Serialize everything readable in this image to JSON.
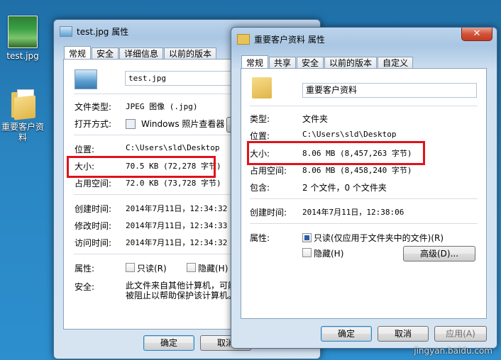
{
  "desktop": {
    "icons": [
      {
        "label": "test.jpg"
      },
      {
        "label": "重要客户资料"
      }
    ]
  },
  "left_window": {
    "title": "test.jpg 属性",
    "tabs": [
      "常规",
      "安全",
      "详细信息",
      "以前的版本"
    ],
    "file_name": "test.jpg",
    "rows": {
      "type_label": "文件类型:",
      "type_value": "JPEG 图像 (.jpg)",
      "open_label": "打开方式:",
      "open_value": "Windows 照片查看器",
      "location_label": "位置:",
      "location_value": "C:\\Users\\sld\\Desktop",
      "size_label": "大小:",
      "size_value": "70.5 KB (72,278 字节)",
      "disk_label": "占用空间:",
      "disk_value": "72.0 KB (73,728 字节)",
      "created_label": "创建时间:",
      "created_value": "2014年7月11日，12:34:32",
      "modified_label": "修改时间:",
      "modified_value": "2014年7月11日，12:34:33",
      "accessed_label": "访问时间:",
      "accessed_value": "2014年7月11日，12:34:32",
      "attr_label": "属性:",
      "readonly_label": "只读(R)",
      "hidden_label": "隐藏(H)",
      "security_label": "安全:",
      "security_line1": "此文件来自其他计算机，可能",
      "security_line2": "被阻止以帮助保护该计算机。"
    },
    "ok_label": "确定",
    "cancel_label": "取消"
  },
  "right_window": {
    "title": "重要客户资料 属性",
    "close_glyph": "✕",
    "tabs": [
      "常规",
      "共享",
      "安全",
      "以前的版本",
      "自定义"
    ],
    "folder_name": "重要客户资料",
    "rows": {
      "type_label": "类型:",
      "type_value": "文件夹",
      "location_label": "位置:",
      "location_value": "C:\\Users\\sld\\Desktop",
      "size_label": "大小:",
      "size_value": "8.06 MB (8,457,263 字节)",
      "disk_label": "占用空间:",
      "disk_value": "8.06 MB (8,458,240 字节)",
      "contains_label": "包含:",
      "contains_value": "2 个文件，0 个文件夹",
      "created_label": "创建时间:",
      "created_value": "2014年7月11日，12:38:06",
      "attr_label": "属性:",
      "readonly_label": "只读(仅应用于文件夹中的文件)(R)",
      "hidden_label": "隐藏(H)",
      "advanced_label": "高级(D)..."
    },
    "ok_label": "确定",
    "cancel_label": "取消",
    "apply_label": "应用(A)"
  },
  "watermark": "jingyan.baidu.com",
  "colors": {
    "highlight": "#e0121a",
    "folder": "#e7c35a"
  }
}
